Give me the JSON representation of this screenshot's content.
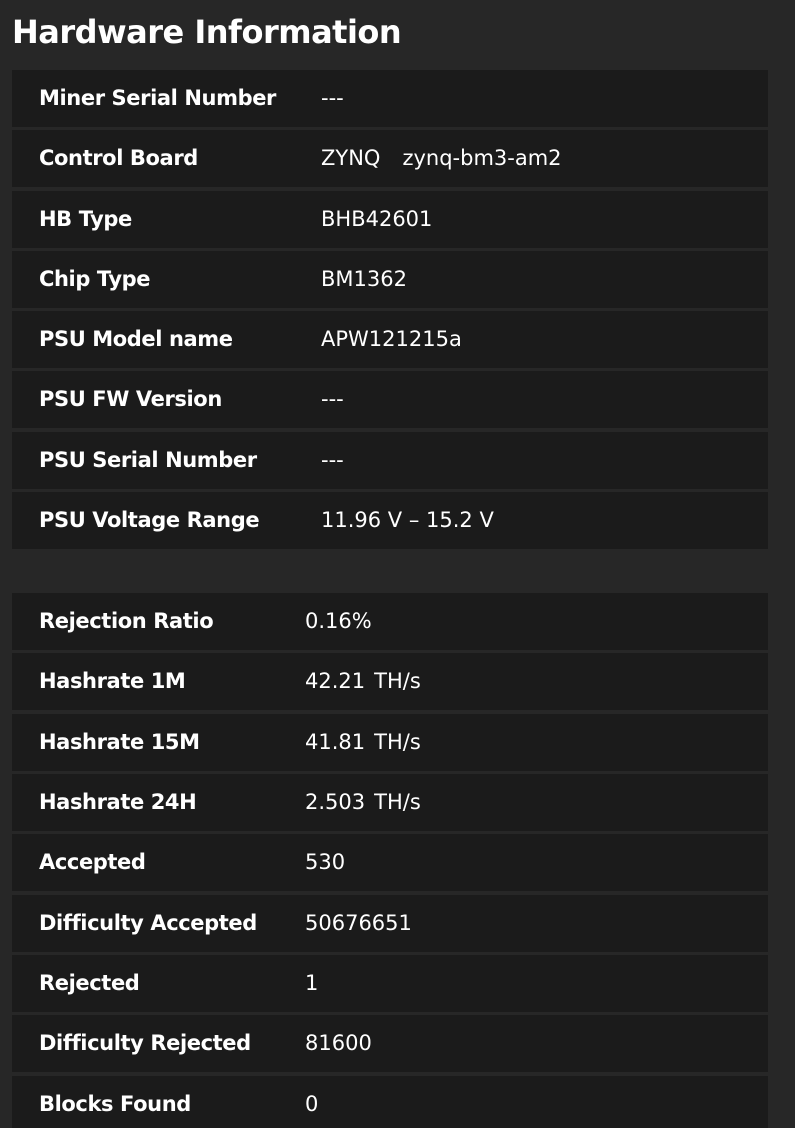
{
  "title": "Hardware Information",
  "hardware": [
    {
      "label": "Miner Serial Number",
      "value": "---"
    },
    {
      "label": "Control Board",
      "value": "ZYNQ",
      "value2": "zynq-bm3-am2"
    },
    {
      "label": "HB Type",
      "value": "BHB42601"
    },
    {
      "label": "Chip Type",
      "value": "BM1362"
    },
    {
      "label": "PSU Model name",
      "value": "APW121215a"
    },
    {
      "label": "PSU FW Version",
      "value": "---"
    },
    {
      "label": "PSU Serial Number",
      "value": "---"
    },
    {
      "label": "PSU Voltage Range",
      "value": "11.96 V – 15.2 V"
    }
  ],
  "stats": [
    {
      "label": "Rejection Ratio",
      "value": "0.16%"
    },
    {
      "label": "Hashrate 1M",
      "value": "42.21",
      "unit": "TH/s"
    },
    {
      "label": "Hashrate 15M",
      "value": "41.81",
      "unit": "TH/s"
    },
    {
      "label": "Hashrate 24H",
      "value": "2.503",
      "unit": "TH/s"
    },
    {
      "label": "Accepted",
      "value": "530"
    },
    {
      "label": "Difficulty Accepted",
      "value": "50676651"
    },
    {
      "label": "Rejected",
      "value": "1"
    },
    {
      "label": "Difficulty Rejected",
      "value": "81600"
    },
    {
      "label": "Blocks Found",
      "value": "0"
    }
  ]
}
